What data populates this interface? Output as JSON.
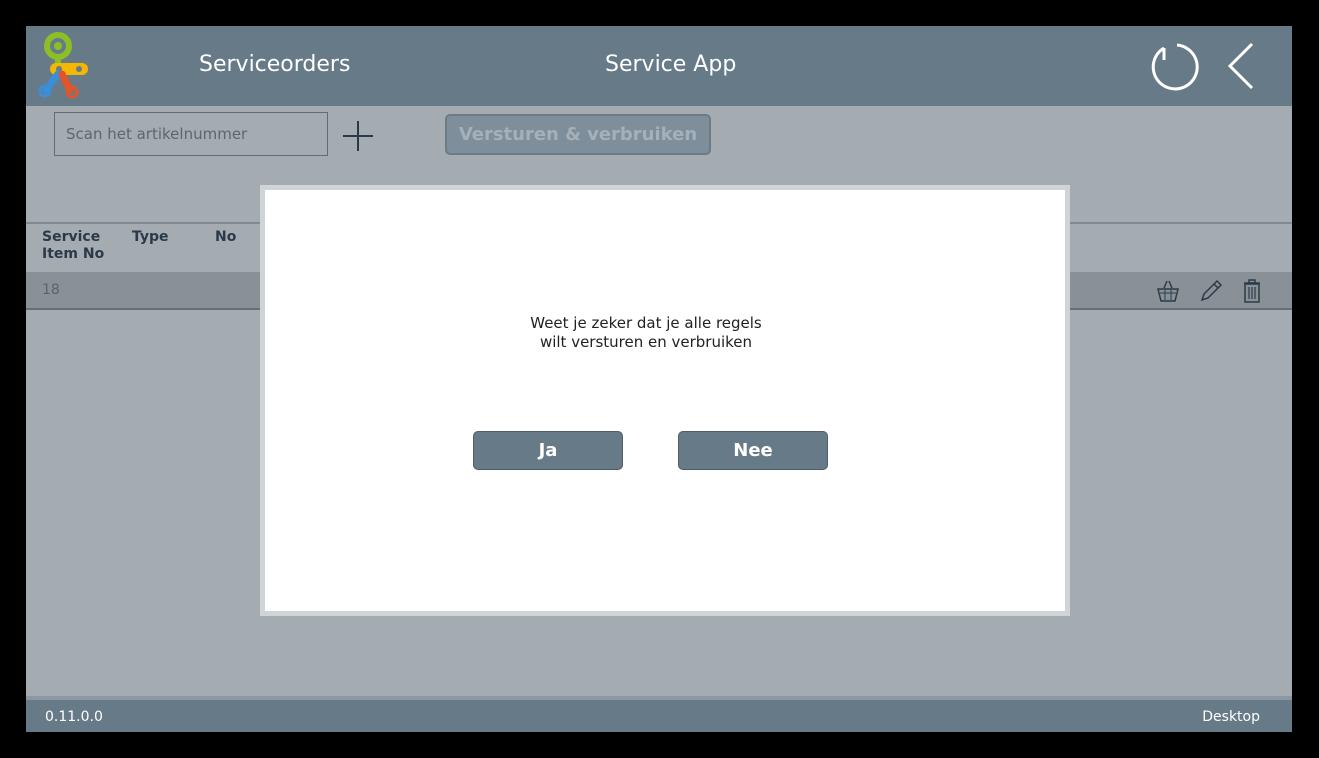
{
  "header": {
    "section_title": "Serviceorders",
    "app_title": "Service App",
    "refresh_icon": "refresh-icon",
    "back_icon": "chevron-left-icon"
  },
  "toolbar": {
    "scan_placeholder": "Scan het artikelnummer",
    "scan_value": "",
    "add_icon": "plus-icon",
    "send_label": "Versturen & verbruiken"
  },
  "table": {
    "columns": [
      "Service\nItem No",
      "Type",
      "No"
    ],
    "rows": [
      {
        "no": "18",
        "actions": [
          "basket-icon",
          "pencil-icon",
          "trash-icon"
        ]
      }
    ]
  },
  "dialog": {
    "message": "Weet je zeker dat je alle regels\nwilt versturen en verbruiken",
    "yes_label": "Ja",
    "no_label": "Nee"
  },
  "footer": {
    "version": "0.11.0.0",
    "device": "Desktop"
  },
  "colors": {
    "header_bg": "#677a88",
    "page_bg": "#a5acb1",
    "logo_green": "#8cbf26",
    "logo_yellow": "#f5b800",
    "logo_blue": "#3a8fd8",
    "logo_red": "#e2542a"
  }
}
